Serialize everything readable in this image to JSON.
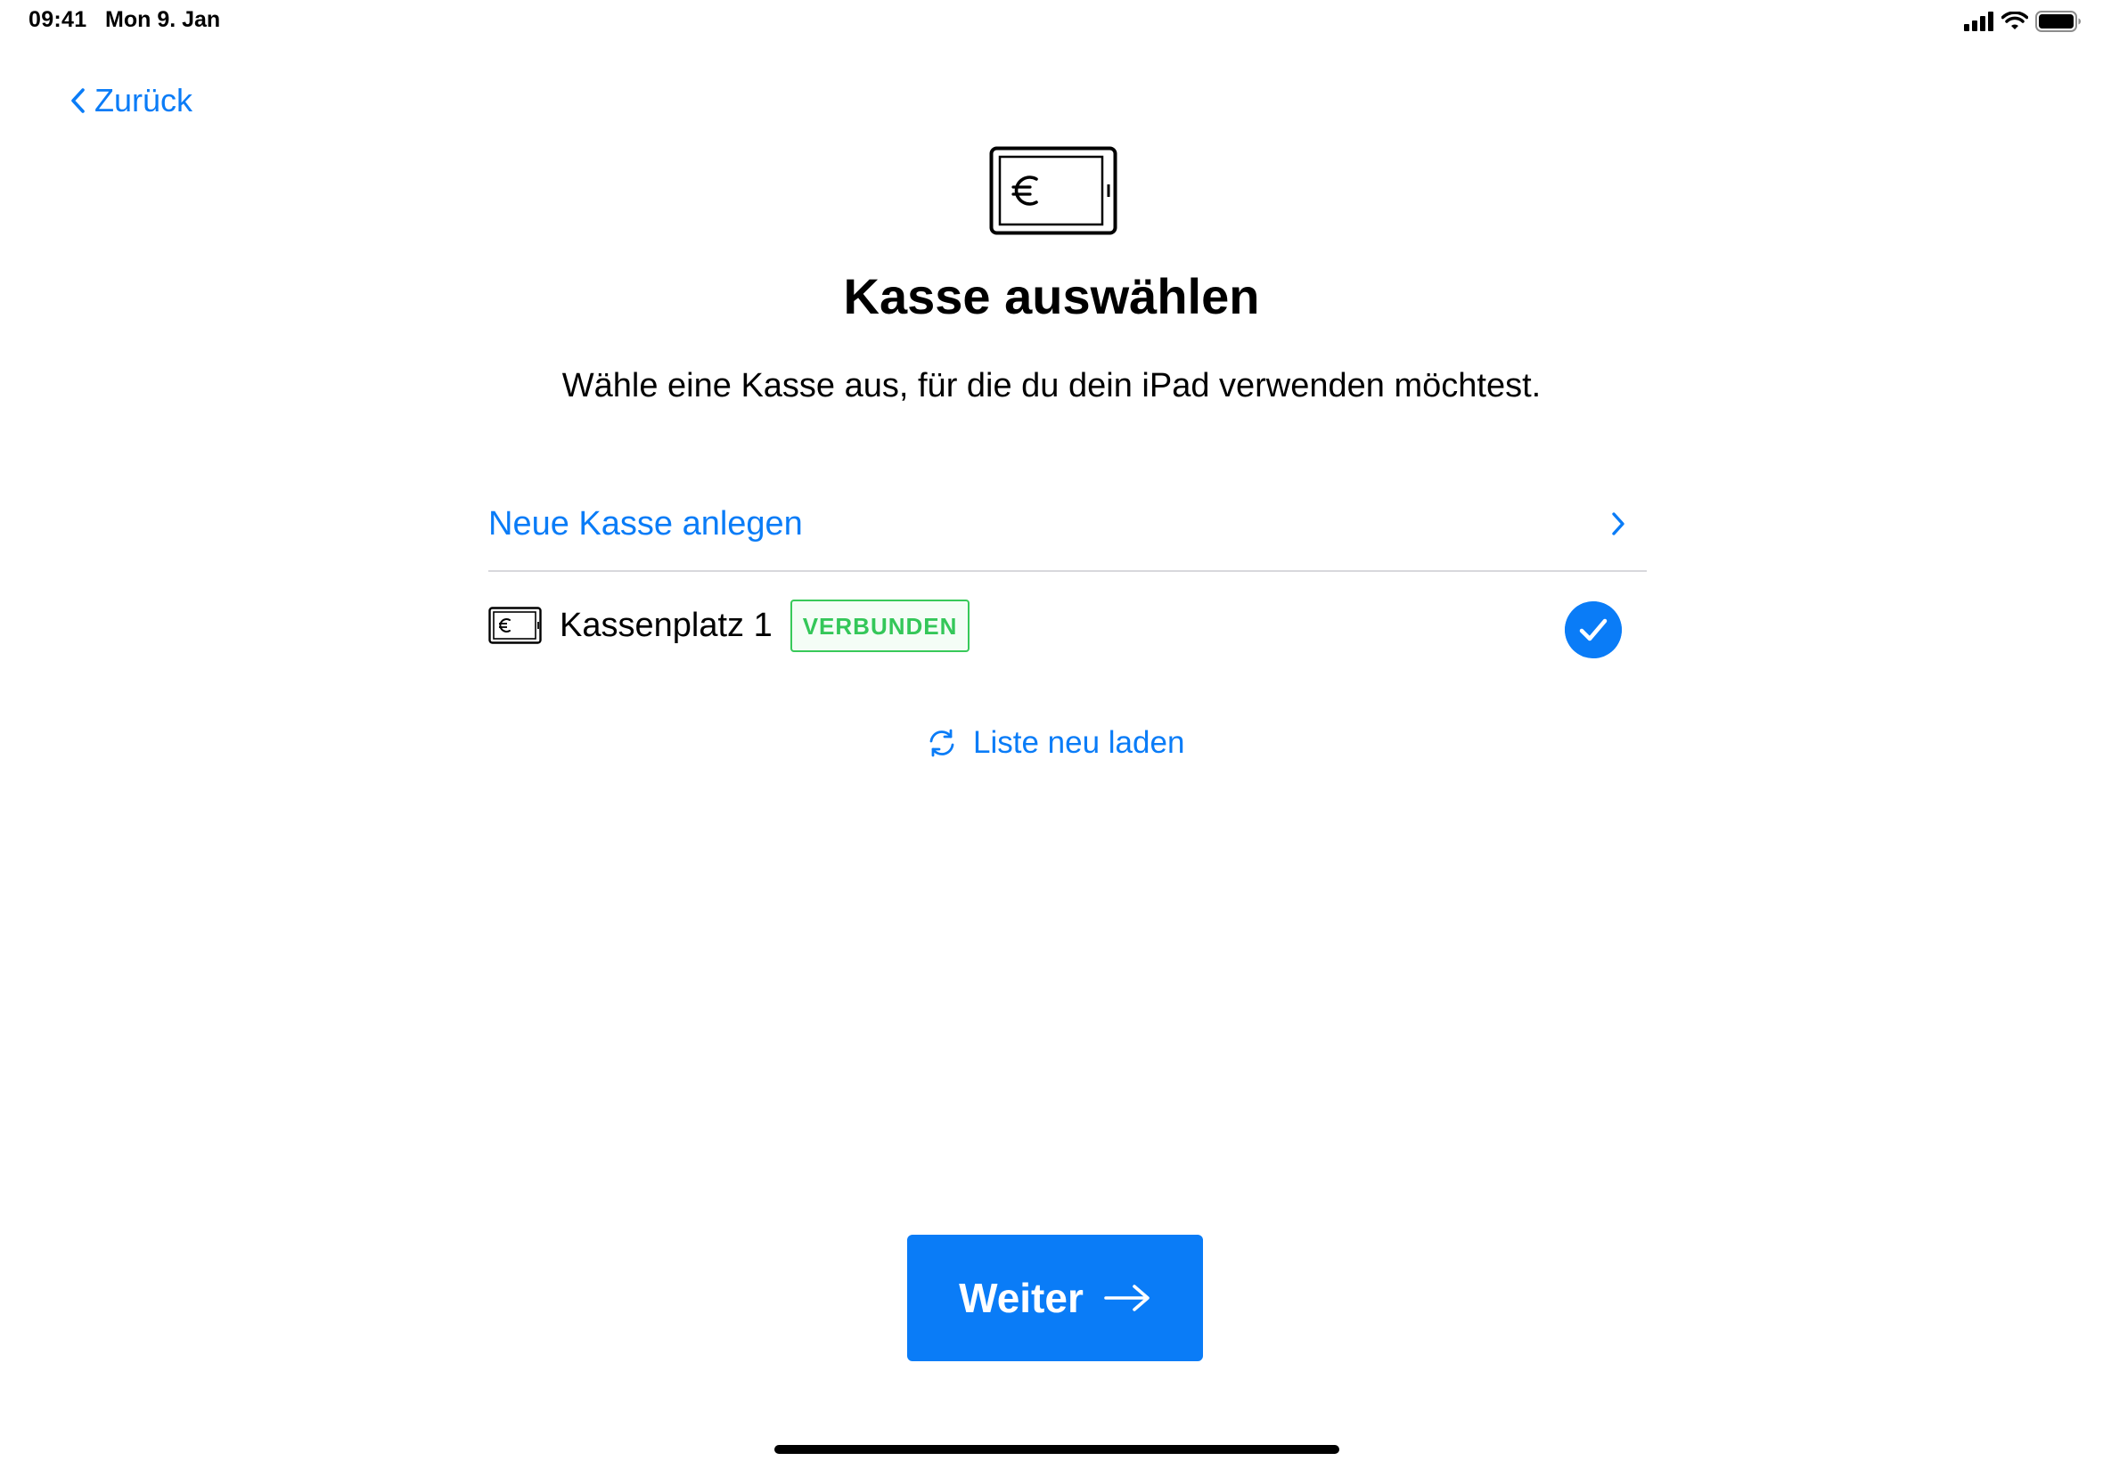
{
  "status_bar": {
    "time": "09:41",
    "date": "Mon 9. Jan",
    "icons": [
      "cellular-signal-icon",
      "wifi-icon",
      "battery-icon"
    ]
  },
  "nav": {
    "back_label": "Zurück"
  },
  "header": {
    "icon": "cash-register-euro-icon",
    "title": "Kasse auswählen",
    "subtitle": "Wähle eine Kasse aus, für die du dein iPad verwenden möchtest."
  },
  "list": {
    "new_register_label": "Neue Kasse anlegen",
    "registers": [
      {
        "name": "Kassenplatz 1",
        "status_badge": "VERBUNDEN",
        "selected": true
      }
    ]
  },
  "reload": {
    "label": "Liste neu laden"
  },
  "footer": {
    "continue_label": "Weiter"
  },
  "colors": {
    "accent": "#0a7cf7",
    "success": "#34c759",
    "text": "#000000",
    "separator": "#d8d8dc",
    "background": "#ffffff"
  }
}
